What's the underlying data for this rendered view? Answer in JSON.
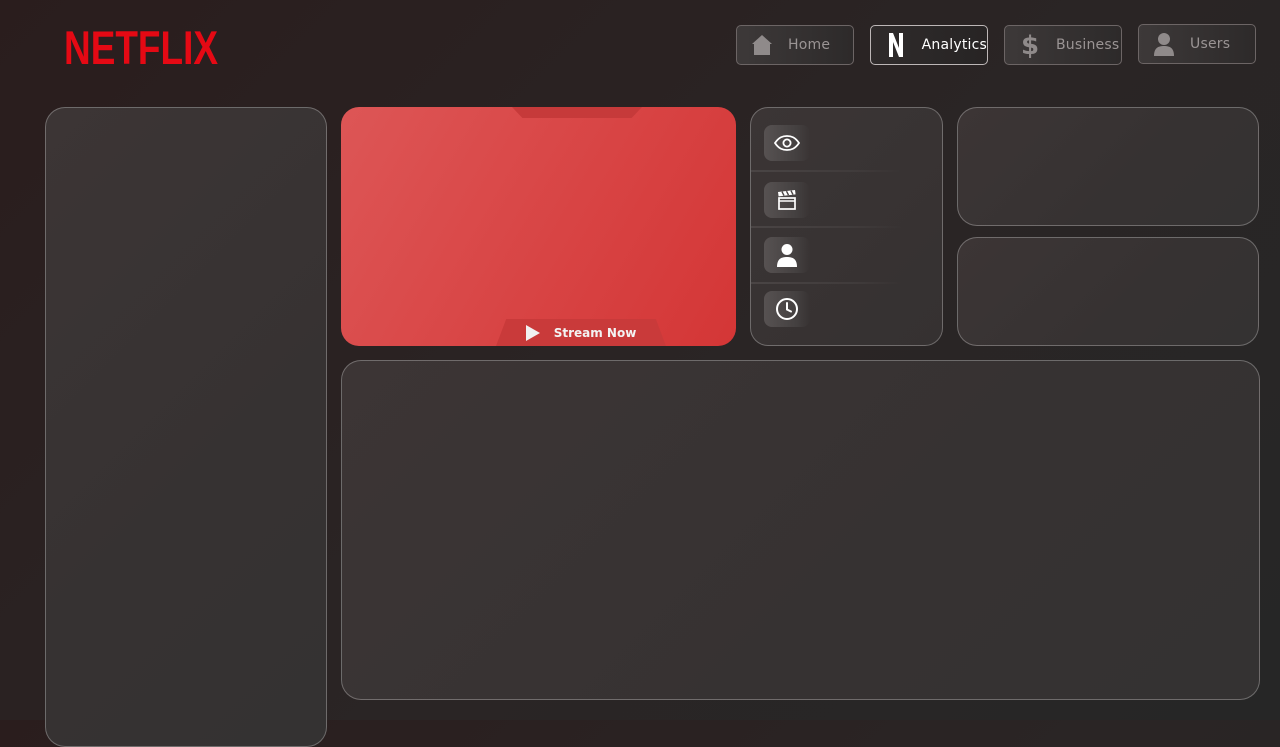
{
  "brand": {
    "logo_text": "NETFLIX",
    "color": "#e50914"
  },
  "nav": {
    "items": [
      {
        "label": "Home",
        "icon": "home-icon",
        "active": false
      },
      {
        "label": "Analytics",
        "icon": "netflix-n-icon",
        "active": true
      },
      {
        "label": "Business",
        "icon": "dollar-icon",
        "active": false
      },
      {
        "label": "Users",
        "icon": "user-icon",
        "active": false
      }
    ]
  },
  "hero": {
    "button_label": "Stream Now",
    "accent": "#d84444"
  },
  "stats": {
    "icons": [
      "eye-icon",
      "clapperboard-icon",
      "user-icon",
      "clock-icon"
    ]
  }
}
